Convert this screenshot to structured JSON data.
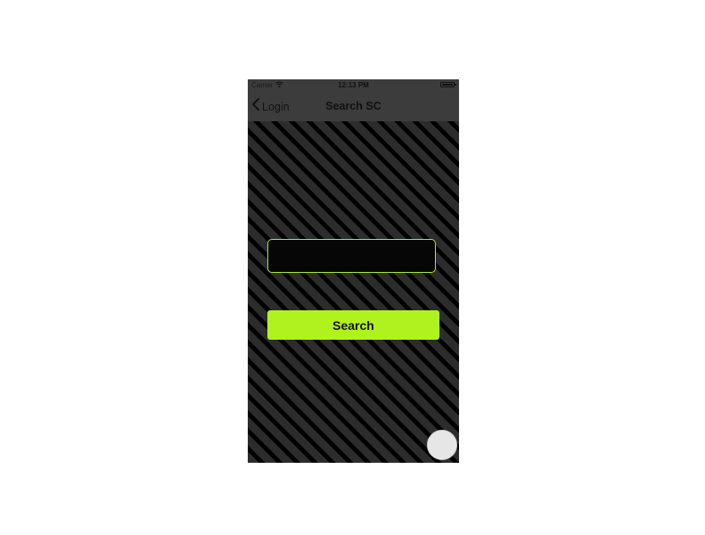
{
  "status_bar": {
    "carrier": "Carrier",
    "time": "12:13 PM",
    "wifi_icon": "wifi-icon",
    "battery_icon": "battery-icon"
  },
  "nav_bar": {
    "back_label": "Login",
    "back_icon": "chevron-left-icon",
    "title": "Search SC"
  },
  "search": {
    "input_value": "",
    "input_placeholder": "",
    "button_label": "Search"
  },
  "colors": {
    "accent": "#b0f21e",
    "bar_background": "#3c3c3c",
    "content_stripe_light": "#2c2c2c",
    "content_stripe_dark": "#000000"
  }
}
